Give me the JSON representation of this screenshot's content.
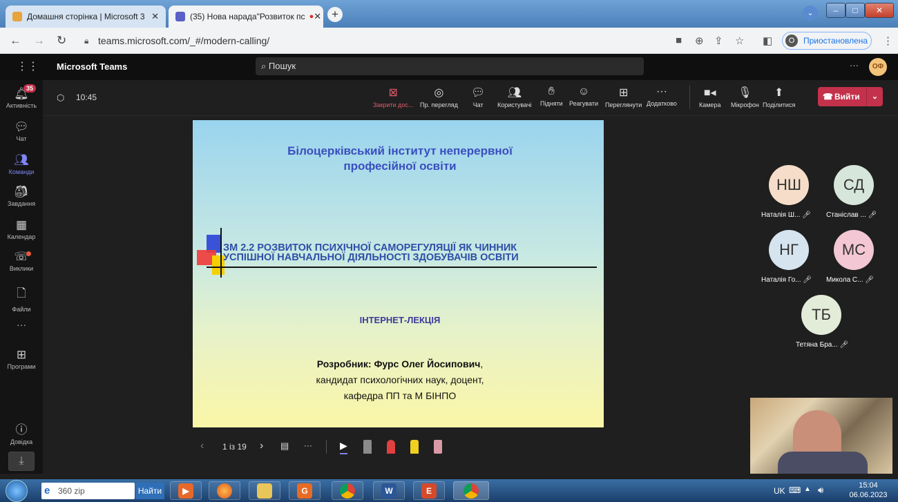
{
  "browser": {
    "tabs": [
      {
        "label": "Домашня сторінка | Microsoft 3",
        "active": false
      },
      {
        "label": "(35) Нова нарада\"Розвиток пс",
        "active": true
      }
    ],
    "new_tab": "+",
    "window_controls": {
      "minimize": "–",
      "maximize": "□",
      "close": "✕"
    },
    "url": "teams.microsoft.com/_#/modern-calling/",
    "profile_label": "Приостановлена",
    "profile_initial": "O"
  },
  "teams": {
    "app_title": "Microsoft Teams",
    "search_placeholder": "Пошук",
    "more": "···",
    "user_initials": "ОФ",
    "rail": [
      {
        "label": "Активність",
        "icon": "bell-icon",
        "badge": "35"
      },
      {
        "label": "Чат",
        "icon": "chat-icon"
      },
      {
        "label": "Команди",
        "icon": "teams-icon",
        "active": true
      },
      {
        "label": "Завдання",
        "icon": "tasks-icon"
      },
      {
        "label": "Календар",
        "icon": "calendar-icon"
      },
      {
        "label": "Виклики",
        "icon": "phone-icon"
      },
      {
        "label": "Файли",
        "icon": "file-icon"
      },
      {
        "label": "···",
        "icon": "more-icon"
      },
      {
        "label": "Програми",
        "icon": "apps-icon"
      },
      {
        "label": "Довідка",
        "icon": "help-icon"
      }
    ],
    "call": {
      "timer": "10:45",
      "controls": [
        {
          "label": "Закрити дос...",
          "icon": "stop-share-icon"
        },
        {
          "label": "Пр. перегляд",
          "icon": "eye-icon"
        },
        {
          "label": "Чат",
          "icon": "chat-icon"
        },
        {
          "label": "Користувачі",
          "icon": "people-icon"
        },
        {
          "label": "Підняти",
          "icon": "hand-icon"
        },
        {
          "label": "Реагувати",
          "icon": "smile-icon"
        },
        {
          "label": "Переглянути",
          "icon": "grid-icon"
        },
        {
          "label": "Додатково",
          "icon": "more-icon"
        },
        {
          "label": "Камера",
          "icon": "camera-icon"
        },
        {
          "label": "Мікрофон",
          "icon": "mic-icon"
        },
        {
          "label": "Поділитися",
          "icon": "share-icon"
        }
      ],
      "leave_label": "Вийти"
    }
  },
  "slide": {
    "institute_line1": "Білоцерківський інститут неперервної",
    "institute_line2": "професійної освіти",
    "topic_line1": "ЗМ 2.2 РОЗВИТОК ПСИХІЧНОЇ САМОРЕГУЛЯЦІЇ ЯК ЧИННИК",
    "topic_line2": "УСПІШНОЇ НАВЧАЛЬНОЇ ДІЯЛЬНОСТІ ЗДОБУВАЧІВ ОСВІТИ",
    "lecture_type": "ІНТЕРНЕТ-ЛЕКЦІЯ",
    "author_label": "Розробник: Фурс Олег Йосипович",
    "author_comma": ",",
    "author_degree": "кандидат психологічних наук, доцент,",
    "author_dept": "кафедра ПП та М БІНПО"
  },
  "presenter_toolbar": {
    "page_indicator": "1 із 19",
    "prev": "‹",
    "next": "›",
    "more": "···"
  },
  "participants": [
    {
      "initials": "НШ",
      "name": "Наталія Ш...",
      "color": "#f6ddc9"
    },
    {
      "initials": "СД",
      "name": "Станіслав ...",
      "color": "#d6e6da"
    },
    {
      "initials": "НГ",
      "name": "Наталія Го...",
      "color": "#d5e4ef"
    },
    {
      "initials": "МС",
      "name": "Микола С...",
      "color": "#f3c7d3"
    },
    {
      "initials": "ТБ",
      "name": "Тетяна Бра...",
      "color": "#e3ecd9"
    }
  ],
  "taskbar": {
    "ie_label": "360 zip",
    "search_button": "Найти",
    "language": "UK",
    "time": "15:04",
    "date": "06.06.2023"
  },
  "colors": {
    "accent": "#7f85f5",
    "leave": "#c4314b",
    "slide_title": "#3a4fbf",
    "slide_topic": "#2e4ea8"
  }
}
